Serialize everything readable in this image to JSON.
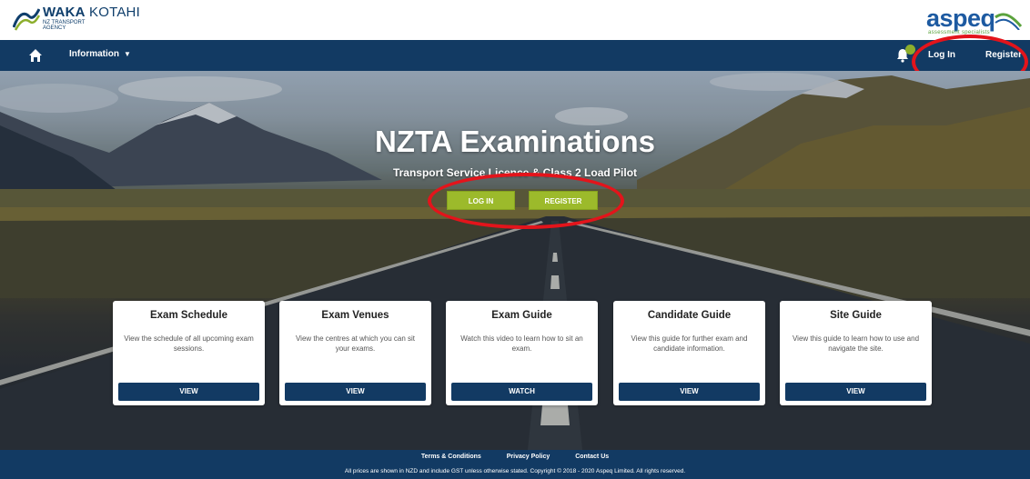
{
  "header": {
    "waka_logo": {
      "brand_bold": "WAKA",
      "brand_light": "KOTAHI",
      "subtitle": "NZ TRANSPORT AGENCY"
    },
    "aspeq_logo": {
      "name": "aspeq",
      "tagline": "assessment specialists"
    }
  },
  "nav": {
    "home_icon": "home-icon",
    "information_label": "Information",
    "bell_icon": "bell-icon",
    "login_label": "Log In",
    "register_label": "Register"
  },
  "hero": {
    "title": "NZTA Examinations",
    "subtitle": "Transport Service Licence & Class 2 Load Pilot",
    "login_button": "LOG IN",
    "register_button": "REGISTER"
  },
  "cards": [
    {
      "title": "Exam Schedule",
      "description": "View the schedule of all upcoming exam sessions.",
      "button": "VIEW"
    },
    {
      "title": "Exam Venues",
      "description": "View the centres at which you can sit your exams.",
      "button": "VIEW"
    },
    {
      "title": "Exam Guide",
      "description": "Watch this video to learn how to sit an exam.",
      "button": "WATCH"
    },
    {
      "title": "Candidate Guide",
      "description": "View this guide for further exam and candidate information.",
      "button": "VIEW"
    },
    {
      "title": "Site Guide",
      "description": "View this guide to learn how to use and navigate the site.",
      "button": "VIEW"
    }
  ],
  "footer": {
    "links": [
      "Terms & Conditions",
      "Privacy Policy",
      "Contact Us"
    ],
    "copyright": "All prices are shown in NZD and include GST unless otherwise stated. Copyright © 2018 - 2020 Aspeq Limited. All rights reserved."
  },
  "colors": {
    "nav_bg": "#123a63",
    "accent_green": "#9cba2b",
    "annotation_red": "#e3141b",
    "aspeq_blue": "#1d5aa1"
  }
}
